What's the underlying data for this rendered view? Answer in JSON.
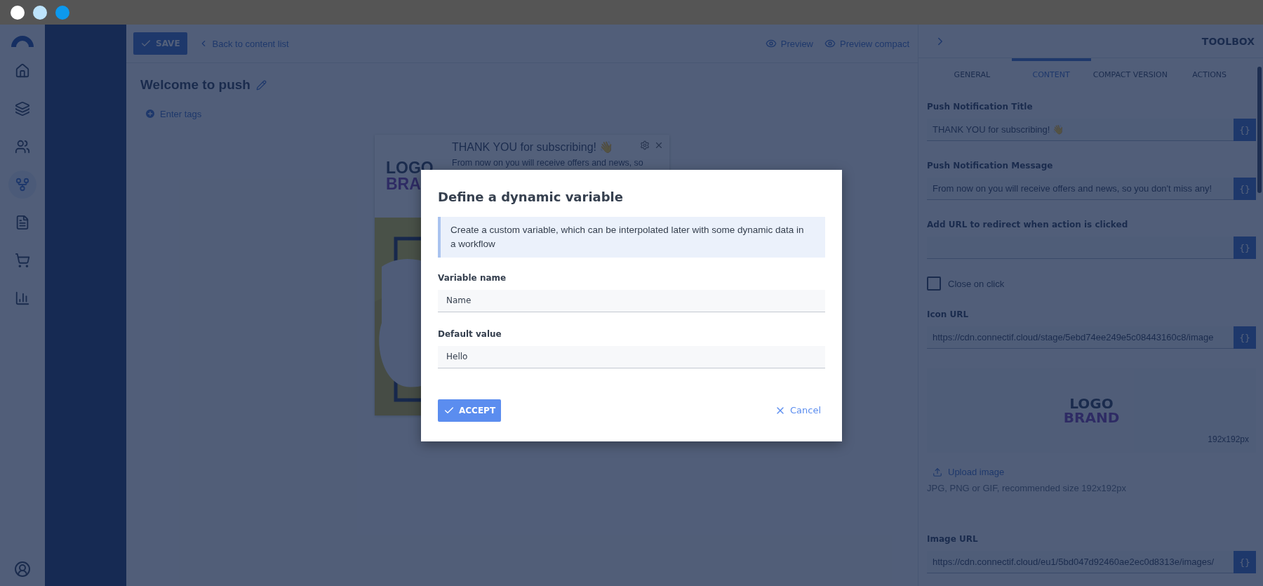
{
  "window_controls": [
    {
      "color": "#ffffff"
    },
    {
      "color": "#bde3fb"
    },
    {
      "color": "#0c99ee"
    }
  ],
  "sidebar": {
    "items": [
      {
        "kind": "home",
        "selected": false
      },
      {
        "kind": "layers",
        "selected": false
      },
      {
        "kind": "contacts",
        "selected": false
      },
      {
        "kind": "workflow",
        "selected": true
      },
      {
        "kind": "content",
        "selected": false
      },
      {
        "kind": "cart",
        "selected": false
      },
      {
        "kind": "stats",
        "selected": false
      }
    ]
  },
  "header": {
    "save_button": "SAVE",
    "back_link": "Back to content list",
    "preview_links": [
      "Preview",
      "Preview compact"
    ]
  },
  "content": {
    "title": "Welcome to push",
    "tags_link": "Enter tags",
    "notification": {
      "logo_top": "LOGO",
      "logo_bottom": "BRA",
      "title": "THANK YOU for subscribing! 👋",
      "message": "From now on you will receive offers and news, so"
    }
  },
  "toolbox": {
    "title": "TOOLBOX",
    "tabs": [
      {
        "label": "GENERAL",
        "selected": false
      },
      {
        "label": "CONTENT",
        "selected": true
      },
      {
        "label": "COMPACT VERSION",
        "selected": false
      },
      {
        "label": "ACTIONS",
        "selected": false
      }
    ],
    "sections": [
      {
        "kind": "field",
        "label": "Push Notification Title",
        "value": "THANK YOU for subscribing! 👋",
        "variable_button": "{}"
      },
      {
        "kind": "field",
        "label": "Push Notification Message",
        "value": "From now on you will receive offers and news, so you don't miss any!",
        "variable_button": "{}"
      },
      {
        "kind": "field",
        "label": "Add URL to redirect when action is clicked",
        "variable_button": "{}"
      },
      {
        "kind": "checkbox",
        "label": "Close on click",
        "checked": false
      },
      {
        "kind": "field",
        "label": "Icon URL",
        "value": "https://cdn.connectif.cloud/stage/5ebd74ee249e5c08443160c8/image",
        "variable_button": "{}"
      },
      {
        "logo_top": "LOGO",
        "logo_bottom": "BRAND",
        "size": "192x192px"
      },
      {
        "kind": "upload",
        "label": "Upload image",
        "hint": "JPG, PNG or GIF, recommended size 192x192px"
      },
      {
        "kind": "field",
        "label": "Image URL",
        "value": "https://cdn.connectif.cloud/eu1/5bd047d92460ae2ec0d8313e/images/",
        "variable_button": "{}"
      }
    ]
  },
  "dialog": {
    "title": "Define a dynamic variable",
    "info": "Create a custom variable, which can be interpolated later with some dynamic data in a workflow",
    "fields": [
      {
        "label": "Variable name",
        "value": "Name"
      },
      {
        "label": "Default value",
        "value": "Hello"
      }
    ],
    "accept_button": "ACCEPT",
    "cancel_button": "Cancel"
  }
}
